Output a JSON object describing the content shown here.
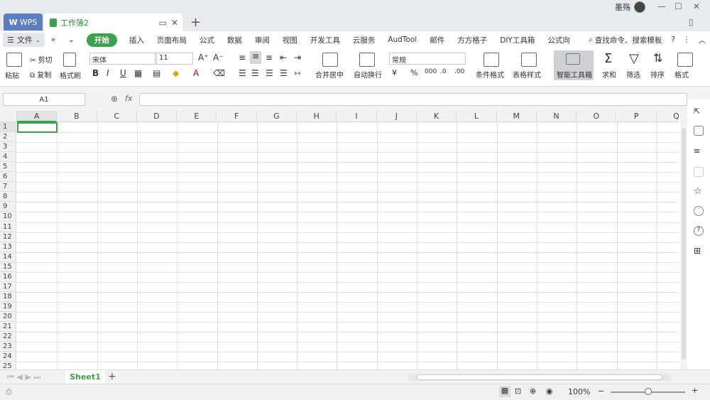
{
  "titlebar": {
    "wps_tab": "WPS",
    "doc_tab": "工作簿2",
    "user_name": "墨殇"
  },
  "menubar": {
    "file": "文件",
    "items": [
      "插入",
      "页面布局",
      "公式",
      "数据",
      "审阅",
      "视图",
      "开发工具",
      "云服务",
      "AudTool",
      "邮件",
      "方方格子",
      "DIY工具箱",
      "公式向"
    ],
    "start": "开始",
    "search": "查找命令、搜索模板"
  },
  "ribbon": {
    "paste": "粘贴",
    "cut": "剪切",
    "copy": "复制",
    "format_painter": "格式刷",
    "font_name": "宋体",
    "font_size": "11",
    "merge_center": "合并居中",
    "wrap_text": "自动换行",
    "number_format": "常规",
    "cond_format": "条件格式",
    "table_style": "表格样式",
    "smart_toolbox": "智能工具箱",
    "sum": "求和",
    "filter": "筛选",
    "sort": "排序",
    "format": "格式"
  },
  "formula_bar": {
    "name_box": "A1",
    "fx": "fx",
    "value": ""
  },
  "sheet": {
    "columns": [
      "A",
      "B",
      "C",
      "D",
      "E",
      "F",
      "G",
      "H",
      "I",
      "J",
      "K",
      "L",
      "M",
      "N",
      "O",
      "P",
      "Q"
    ],
    "rows": [
      "1",
      "2",
      "3",
      "4",
      "5",
      "6",
      "7",
      "8",
      "9",
      "10",
      "11",
      "12",
      "13",
      "14",
      "15",
      "16",
      "17",
      "18",
      "19",
      "20",
      "21",
      "22",
      "23",
      "24",
      "25"
    ],
    "active_tab": "Sheet1"
  },
  "status": {
    "zoom": "100%"
  }
}
